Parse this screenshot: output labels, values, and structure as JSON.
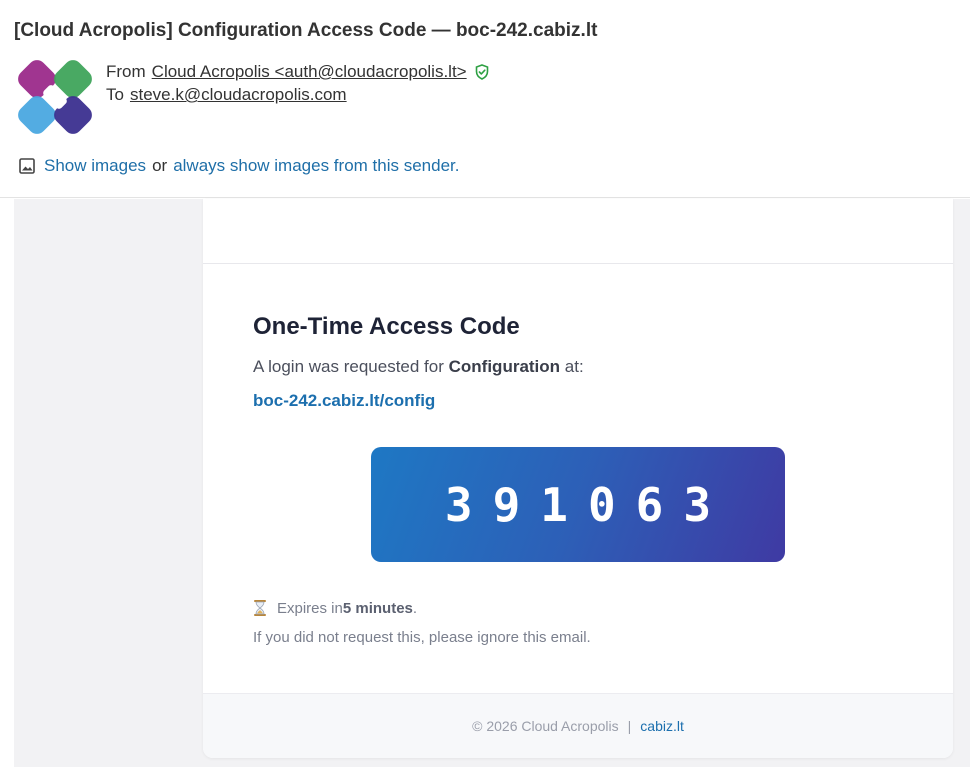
{
  "email": {
    "subject": "[Cloud Acropolis] Configuration Access Code — boc-242.cabiz.lt",
    "from_label": "From",
    "from_value": "Cloud Acropolis <auth@cloudacropolis.lt>",
    "to_label": "To",
    "to_value": "steve.k@cloudacropolis.com",
    "images_bar": {
      "icon": "image-icon",
      "show_images": "Show images",
      "or": "or",
      "always_show": "always show images from this sender."
    }
  },
  "message": {
    "heading": "One-Time Access Code",
    "intro_prefix": "A login was requested for ",
    "intro_bold": "Configuration",
    "intro_suffix": " at:",
    "url": "boc-242.cabiz.lt/config",
    "code": "391063",
    "expires_prefix": "Expires in ",
    "expires_bold": "5 minutes",
    "expires_suffix": ".",
    "ignore_text": "If you did not request this, please ignore this email.",
    "footer_copyright": "© 2026 Cloud Acropolis",
    "footer_sep": "|",
    "footer_link": "cabiz.lt"
  },
  "colors": {
    "link": "#1f6fa8",
    "code_gradient_start": "#1e78c4",
    "code_gradient_end": "#3f3aa3",
    "verified": "#2ea043",
    "logo_purple": "#9b2a8a",
    "logo_green": "#3fa45b",
    "logo_blue": "#4aa8e0",
    "logo_indigo": "#3b2f8f"
  }
}
